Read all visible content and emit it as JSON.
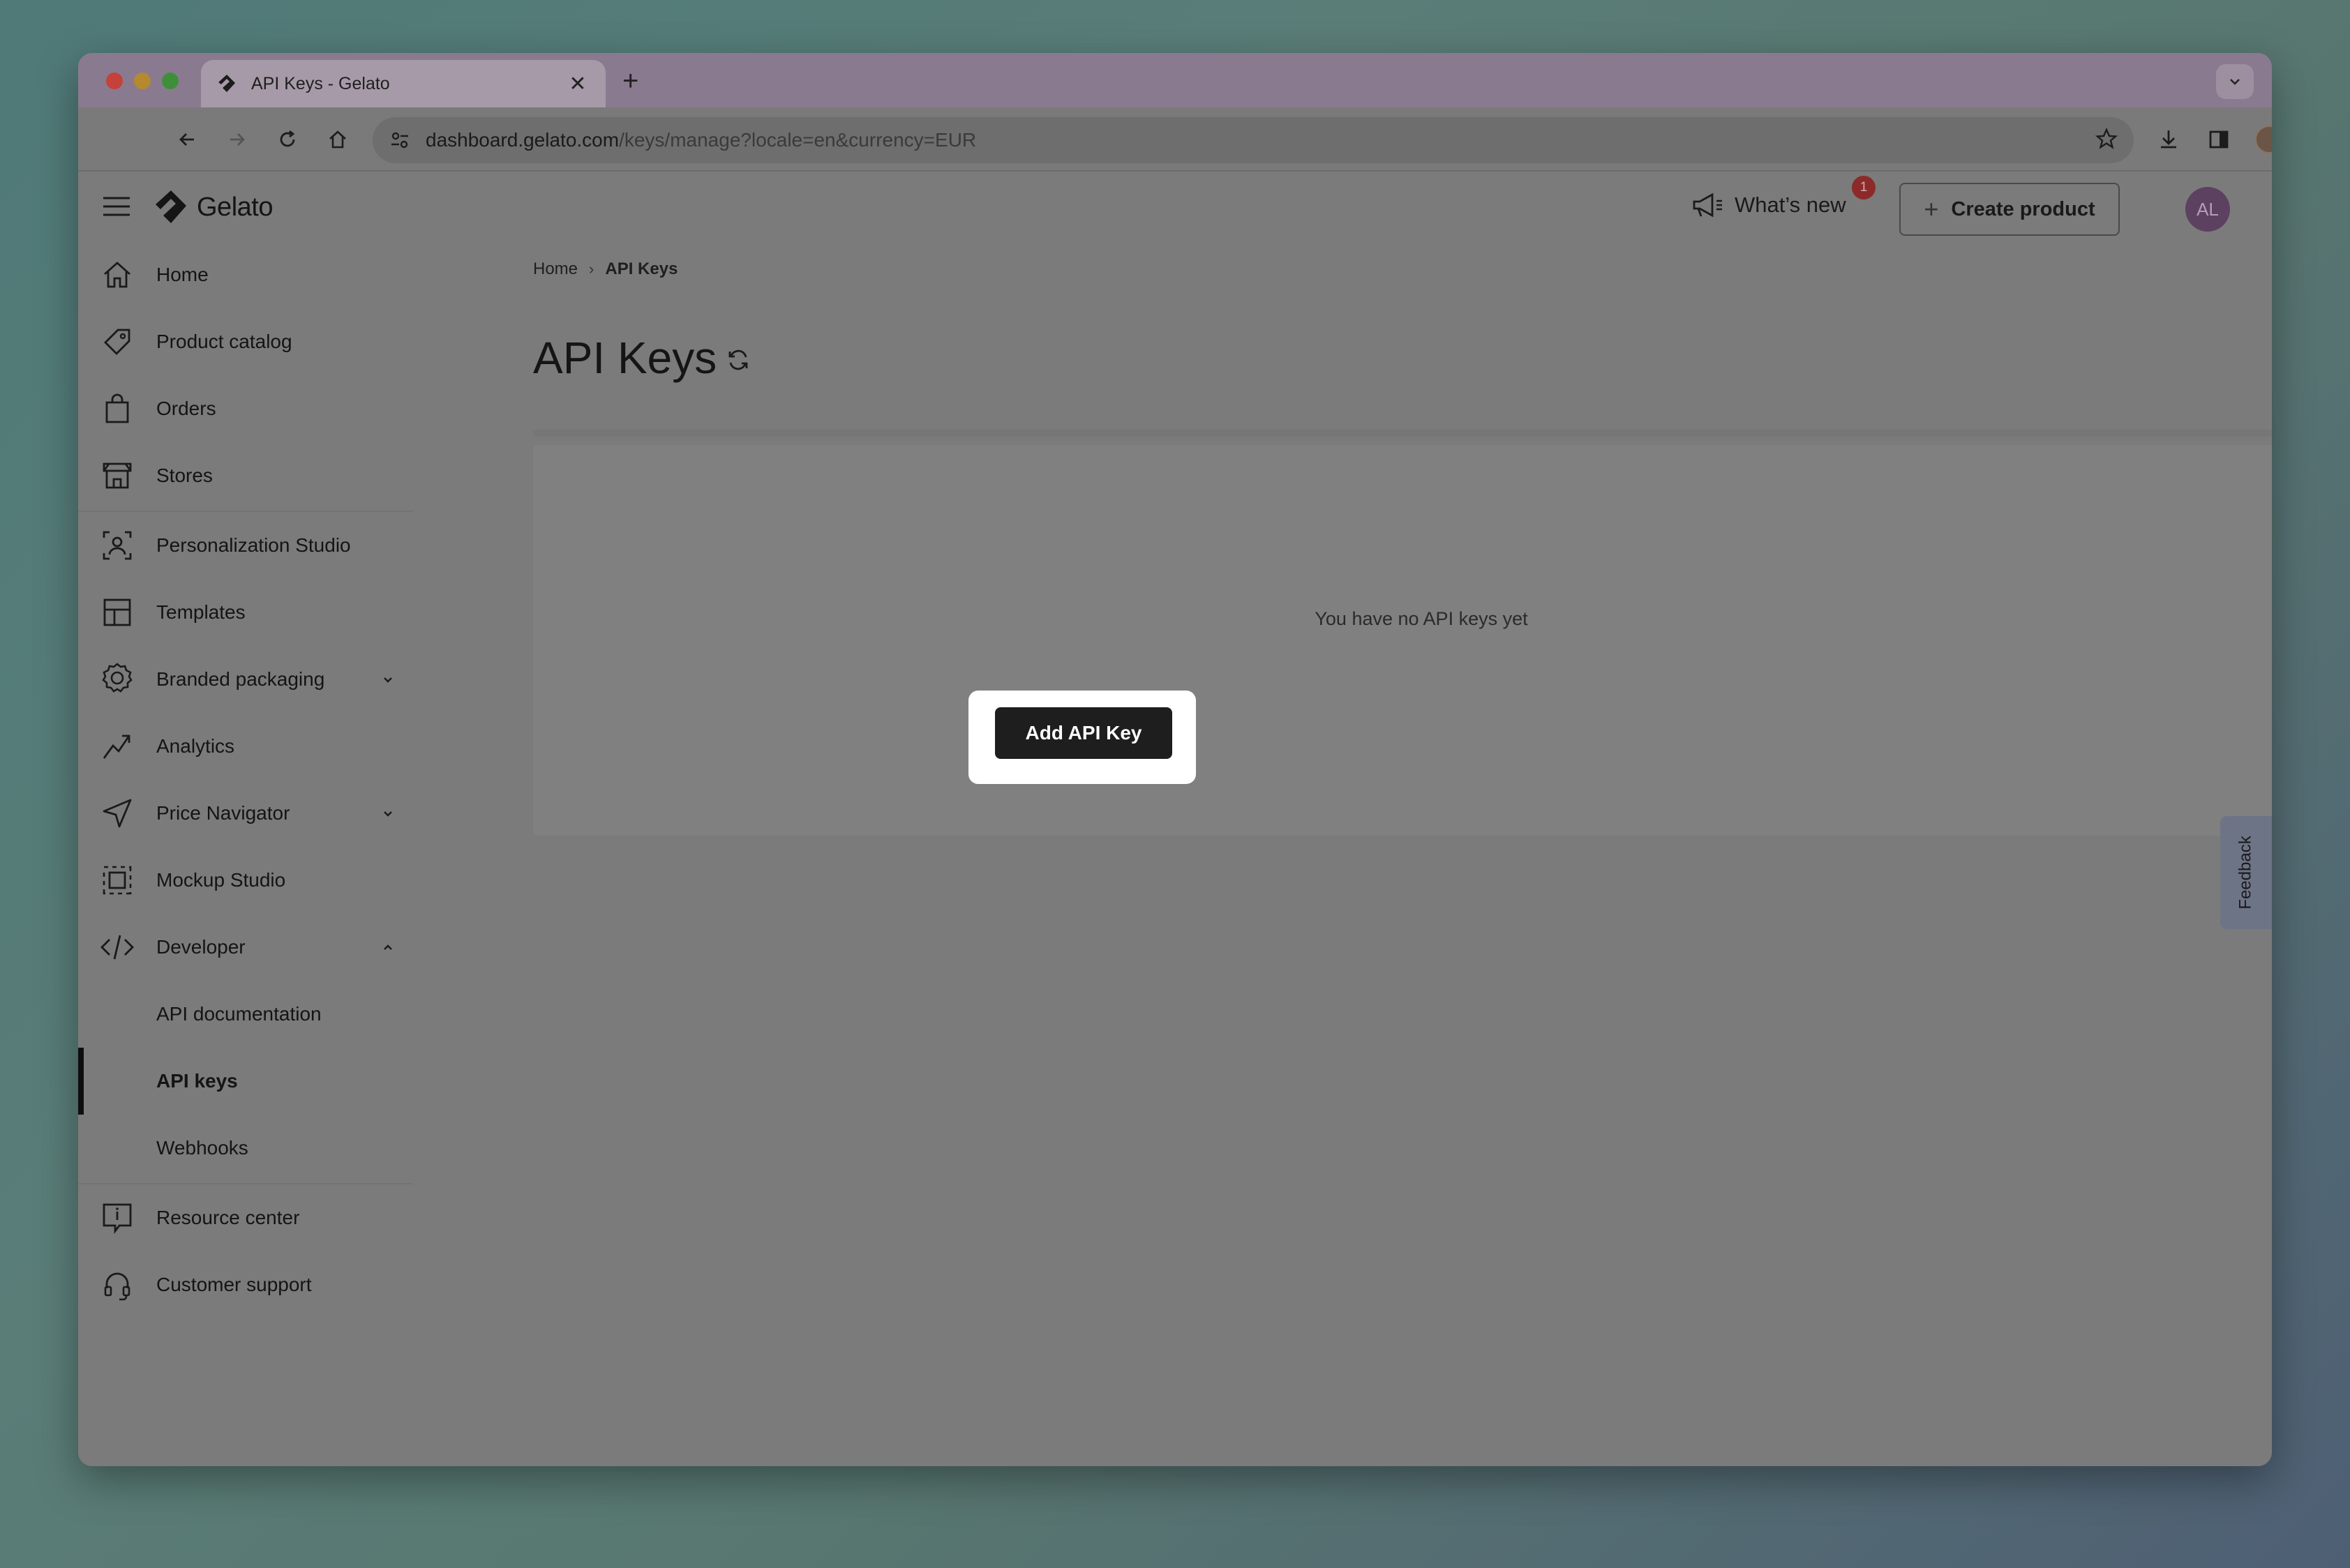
{
  "browser": {
    "tab_title": "API Keys - Gelato",
    "url_host": "dashboard.gelato.com",
    "url_path": "/keys/manage?locale=en&currency=EUR"
  },
  "header": {
    "brand": "Gelato",
    "whats_new_label": "What’s new",
    "notification_count": "1",
    "create_product_label": "Create product",
    "avatar_initials": "AL"
  },
  "sidebar": {
    "items": [
      {
        "label": "Home",
        "icon": "home-icon"
      },
      {
        "label": "Product catalog",
        "icon": "tag-icon"
      },
      {
        "label": "Orders",
        "icon": "shopping-bag-icon"
      },
      {
        "label": "Stores",
        "icon": "store-icon"
      },
      {
        "label": "Personalization Studio",
        "icon": "personalization-icon"
      },
      {
        "label": "Templates",
        "icon": "template-icon"
      },
      {
        "label": "Branded packaging",
        "icon": "badge-icon"
      },
      {
        "label": "Analytics",
        "icon": "analytics-icon"
      },
      {
        "label": "Price Navigator",
        "icon": "navigation-icon"
      },
      {
        "label": "Mockup Studio",
        "icon": "mockup-icon"
      },
      {
        "label": "Developer",
        "icon": "code-icon"
      },
      {
        "label": "API documentation"
      },
      {
        "label": "API keys"
      },
      {
        "label": "Webhooks"
      },
      {
        "label": "Resource center",
        "icon": "resource-icon"
      },
      {
        "label": "Customer support",
        "icon": "headset-icon"
      }
    ]
  },
  "main": {
    "breadcrumb_home": "Home",
    "breadcrumb_current": "API Keys",
    "title": "API Keys",
    "empty_message": "You have no API keys yet",
    "add_button_label": "Add API Key"
  },
  "feedback_label": "Feedback"
}
